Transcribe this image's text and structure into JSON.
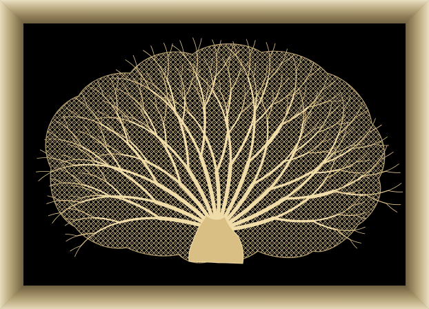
{
  "artwork": {
    "subject": "sea-fan-coral-icon",
    "colors": {
      "background": "#000000",
      "coral": "#d8c08a",
      "coral_highlight": "#f0dca8",
      "frame_light": "#e9dfc2",
      "frame_dark": "#6f6142"
    }
  }
}
